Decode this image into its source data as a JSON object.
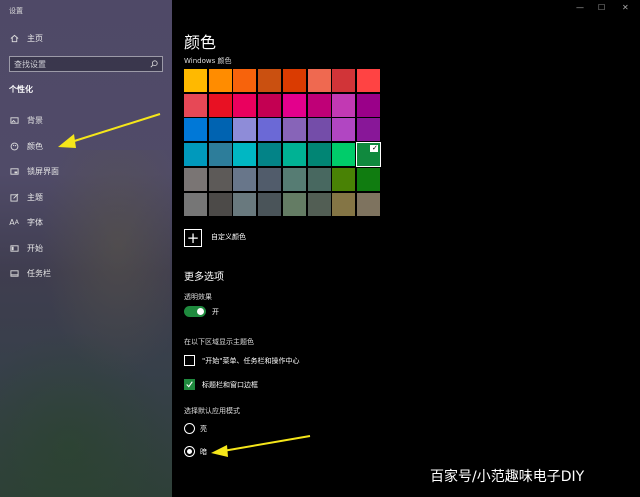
{
  "window": {
    "title": "设置",
    "controls": [
      "—",
      "☐",
      "✕"
    ]
  },
  "sidebar": {
    "home": "主页",
    "search_placeholder": "查找设置",
    "section": "个性化",
    "items": [
      {
        "label": "背景",
        "icon": "image-icon"
      },
      {
        "label": "颜色",
        "icon": "palette-icon"
      },
      {
        "label": "锁屏界面",
        "icon": "lock-screen-icon"
      },
      {
        "label": "主题",
        "icon": "brush-icon"
      },
      {
        "label": "字体",
        "icon": "font-icon"
      },
      {
        "label": "开始",
        "icon": "start-icon"
      },
      {
        "label": "任务栏",
        "icon": "taskbar-icon"
      }
    ]
  },
  "main": {
    "title": "颜色",
    "windows_colors_label": "Windows 颜色",
    "swatches": [
      [
        "#ffb900",
        "#ff8c00",
        "#f7630c",
        "#ca5010",
        "#da3b01",
        "#ef6950",
        "#d13438",
        "#ff4343"
      ],
      [
        "#e74856",
        "#e81123",
        "#ea005e",
        "#c30052",
        "#e3008c",
        "#bf0077",
        "#c239b3",
        "#9a0089"
      ],
      [
        "#0078d7",
        "#0063b1",
        "#8e8cd8",
        "#6b69d6",
        "#8764b8",
        "#744da9",
        "#b146c2",
        "#881798"
      ],
      [
        "#0099bc",
        "#2d7d9a",
        "#00b7c3",
        "#038387",
        "#00b294",
        "#018574",
        "#00cc6a",
        "#10893e"
      ],
      [
        "#7a7574",
        "#5d5a58",
        "#68768a",
        "#515c6b",
        "#567c73",
        "#486860",
        "#498205",
        "#107c10"
      ],
      [
        "#767676",
        "#4c4a48",
        "#69797e",
        "#4a5459",
        "#647c64",
        "#525e54",
        "#847545",
        "#7e735f"
      ]
    ],
    "selected_swatch": "#10893e",
    "custom_color_label": "自定义颜色",
    "more_options": "更多选项",
    "transparency_label": "透明效果",
    "transparency_state": "开",
    "accent_surfaces_label": "在以下区域显示主题色",
    "check_start": "\"开始\"菜单、任务栏和操作中心",
    "check_titlebar": "标题栏和窗口边框",
    "app_mode_label": "选择默认应用模式",
    "mode_light": "亮",
    "mode_dark": "暗"
  },
  "watermark": "百家号/小范趣味电子DIY",
  "colors": {
    "accent": "#1f8a3e",
    "annotation_arrow": "#f5e61a"
  }
}
